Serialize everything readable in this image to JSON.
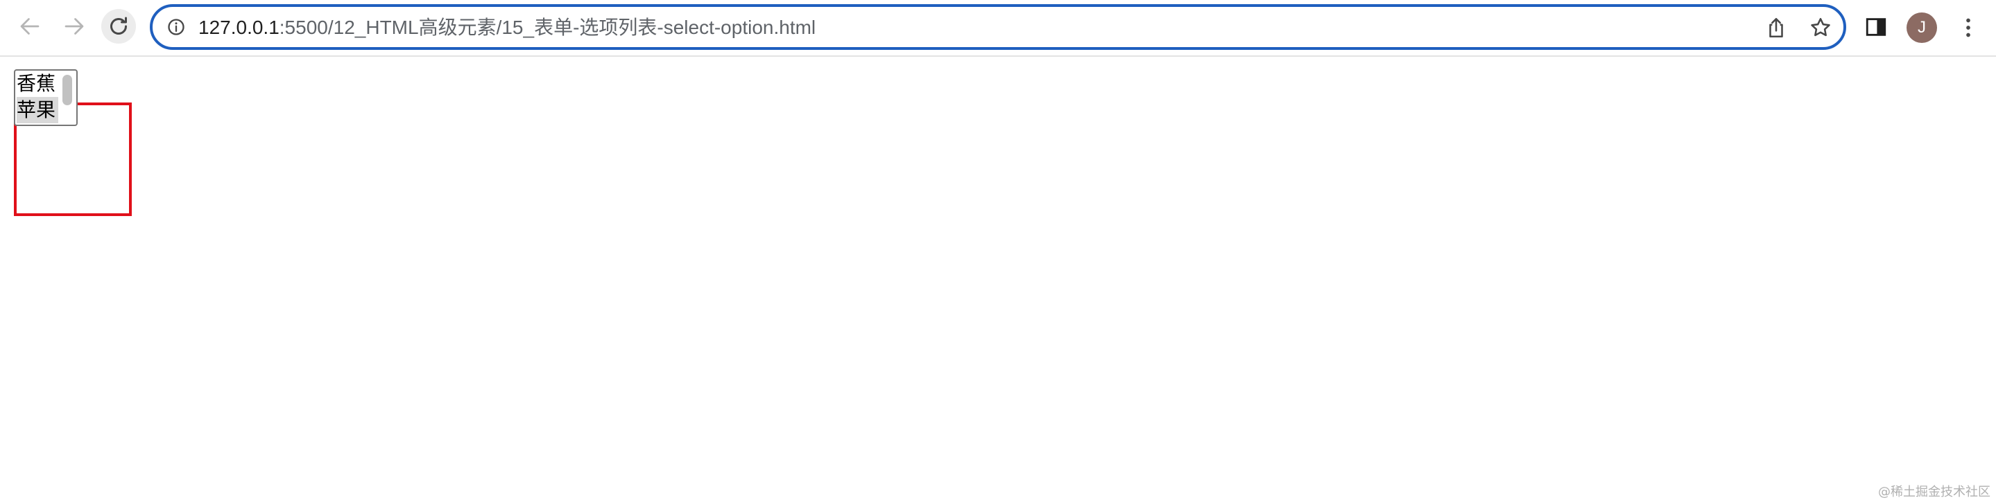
{
  "browser": {
    "url_host": "127.0.0.1",
    "url_rest": ":5500/12_HTML高级元素/15_表单-选项列表-select-option.html",
    "avatar_initial": "J",
    "icons": {
      "back": "arrow-left-icon",
      "forward": "arrow-right-icon",
      "reload": "reload-icon",
      "site_info": "info-icon",
      "share": "share-icon",
      "bookmark": "star-icon",
      "side_panel": "side-panel-icon",
      "menu": "kebab-menu-icon"
    },
    "colors": {
      "omnibox_border": "#1f5fbf",
      "avatar": "#8c6b63"
    }
  },
  "page": {
    "select": {
      "options": [
        "香蕉",
        "苹果"
      ],
      "selected": "苹果"
    },
    "highlight_color": "#e0101a",
    "watermark": "@稀土掘金技术社区"
  }
}
